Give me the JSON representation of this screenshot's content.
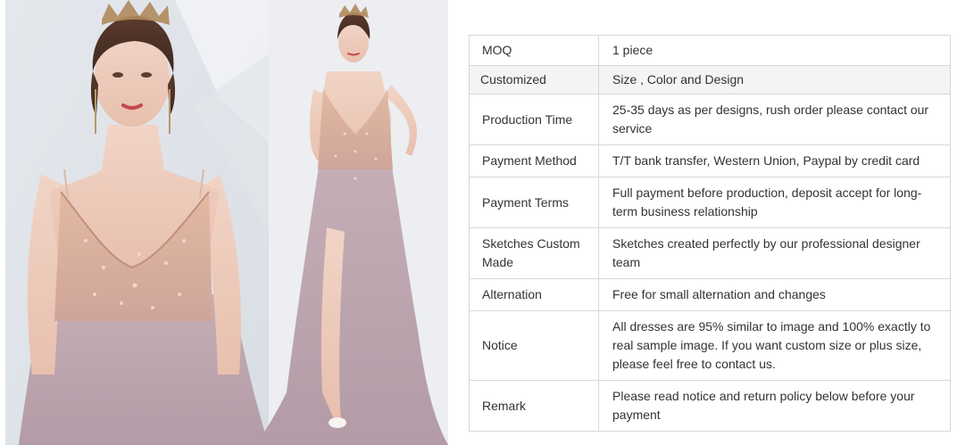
{
  "product": {
    "image_alt": "pink beaded spaghetti strap tulle evening gown with crown",
    "colors": {
      "dress": "#c9a9ac",
      "tulle": "#bba3ad",
      "bodice_beading": "#d8a98e",
      "background": "#e6e9ee"
    }
  },
  "spec_table": {
    "rows": [
      {
        "key": "MOQ",
        "value": "1 piece"
      },
      {
        "key": "Customized",
        "value": "Size , Color and Design"
      },
      {
        "key": "Production Time",
        "value": "25-35 days as per designs, rush order please contact our service"
      },
      {
        "key": "Payment Method",
        "value": "T/T bank transfer, Western Union, Paypal by credit card"
      },
      {
        "key": "Payment Terms",
        "value": "Full payment before production, deposit accept for long-term business relationship"
      },
      {
        "key": "Sketches Custom Made",
        "value": "Sketches created perfectly by our professional designer team"
      },
      {
        "key": "Alternation",
        "value": "Free for small alternation and changes"
      },
      {
        "key": "Notice",
        "value": "All dresses are 95% similar to image and 100% exactly to real sample image. If you want custom size or plus size, please feel free to contact us."
      },
      {
        "key": "Remark",
        "value": "Please read notice and return policy below before your payment"
      }
    ],
    "colors": {
      "border": "#d7d7d7",
      "shaded_row": "#f4f4f4",
      "text": "#333333"
    }
  }
}
